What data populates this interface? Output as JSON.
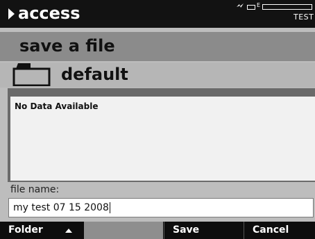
{
  "header": {
    "app_title": "access",
    "mode": "TEST",
    "battery_letter": "E",
    "icons": [
      "play-arrow-icon",
      "bolt-icon",
      "battery-icon",
      "level-bar"
    ],
    "level_fraction": 0
  },
  "screen": {
    "title": "save a file"
  },
  "folder": {
    "name": "default",
    "icon": "folder-icon"
  },
  "file_list": {
    "empty_message": "No Data Available"
  },
  "file_name": {
    "label": "file name:",
    "value": "my test 07 15 2008"
  },
  "softkeys": {
    "folder": "Folder",
    "blank": "",
    "save": "Save",
    "cancel": "Cancel"
  },
  "colors": {
    "header_bg": "#121212",
    "title_band": "#8b8b8b",
    "folder_band": "#b6b6b6",
    "softkey_bar": "#0d0d0d"
  }
}
